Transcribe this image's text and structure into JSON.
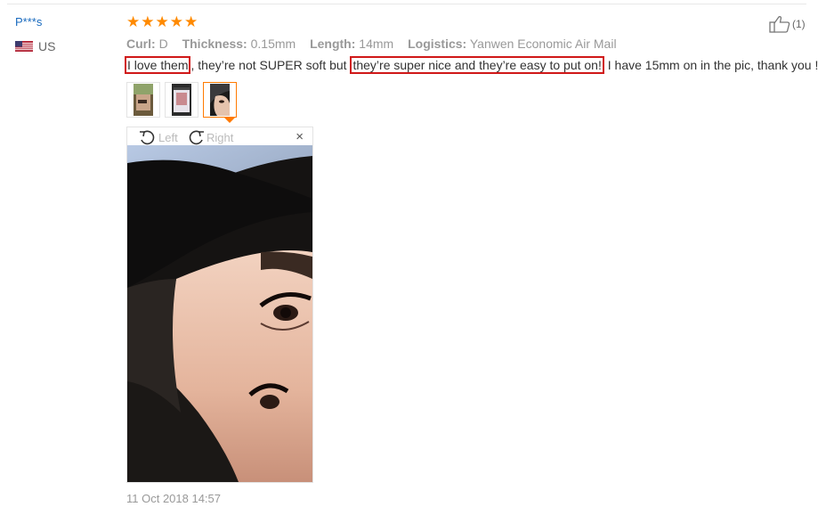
{
  "review": {
    "username": "P***s",
    "country": "US",
    "rating": 5,
    "likes": "(1)",
    "attributes": [
      {
        "key": "Curl:",
        "value": "D"
      },
      {
        "key": "Thickness:",
        "value": "0.15mm"
      },
      {
        "key": "Length:",
        "value": "14mm"
      },
      {
        "key": "Logistics:",
        "value": "Yanwen Economic Air Mail"
      }
    ],
    "text": {
      "part1": "I love them",
      "part2": ", they’re not SUPER soft but ",
      "part3": "they’re super nice and they’re easy to put on!",
      "part4": " I have 15mm on in the pic, thank you !"
    },
    "date": "11 Oct 2018 14:57"
  },
  "viewer": {
    "rotate_left_label": "Left",
    "rotate_right_label": "Right",
    "close_glyph": "×"
  },
  "colors": {
    "username": "#1a6bbf",
    "star": "#ff8a00",
    "highlight_border": "#d01818",
    "active_thumb": "#ff7a00"
  }
}
